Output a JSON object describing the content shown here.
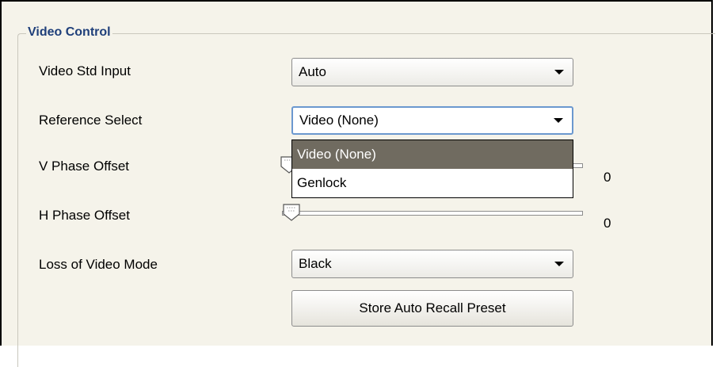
{
  "group": {
    "title": "Video Control"
  },
  "video_std_input": {
    "label": "Video Std Input",
    "value": "Auto"
  },
  "reference_select": {
    "label": "Reference Select",
    "value": "Video (None)",
    "options": [
      "Video (None)",
      "Genlock"
    ],
    "selected_index": 0
  },
  "v_phase_offset": {
    "label": "V Phase Offset",
    "value": "0"
  },
  "h_phase_offset": {
    "label": "H Phase Offset",
    "value": "0"
  },
  "loss_of_video_mode": {
    "label": "Loss of Video Mode",
    "value": "Black"
  },
  "store_button": {
    "label": "Store Auto Recall Preset"
  },
  "colors": {
    "group_title": "#1f3f7a",
    "focus_border": "#6b98cf",
    "selected_option_bg": "#706b60"
  }
}
